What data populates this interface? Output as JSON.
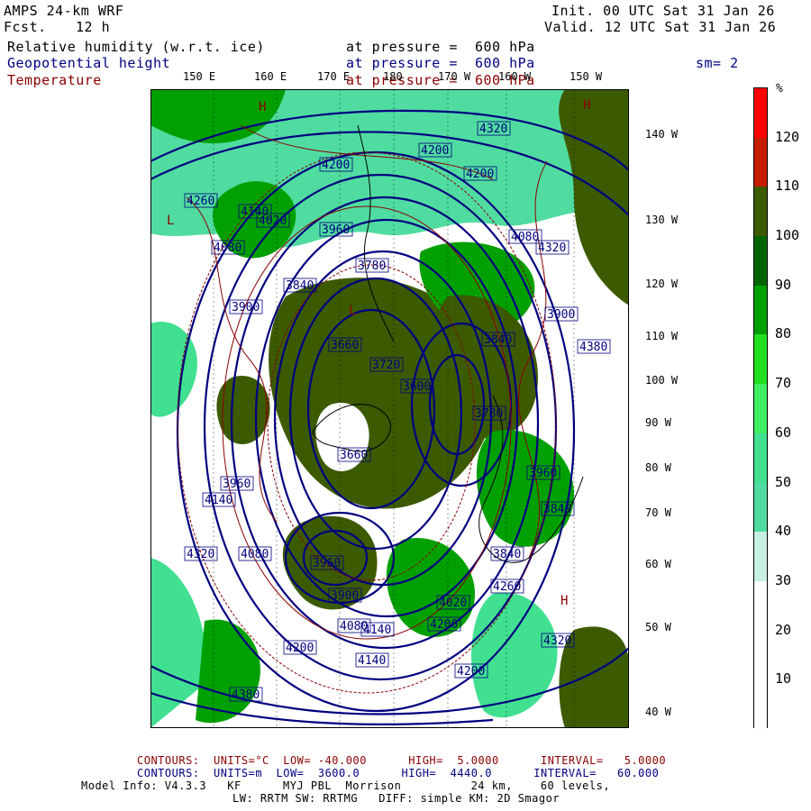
{
  "header": {
    "model": "AMPS 24-km WRF",
    "fcst_label": "Fcst.",
    "fcst_value": "12 h",
    "init": "Init. 00 UTC Sat 31 Jan 26",
    "valid": "Valid. 12 UTC Sat 31 Jan 26",
    "fields": [
      {
        "name": "Relative humidity (w.r.t. ice)",
        "level": "at pressure =  600 hPa",
        "color": "#000000"
      },
      {
        "name": "Geopotential height",
        "level": "at pressure =  600 hPa",
        "color": "#000080"
      },
      {
        "name": "Temperature",
        "level": "at pressure =  600 hPa",
        "color": "#8b0000"
      }
    ],
    "smooth": "sm= 2"
  },
  "longitude_labels": [
    "150 E",
    "160 E",
    "170 E",
    "180",
    "170 W",
    "160 W",
    "150 W"
  ],
  "latitude_labels": [
    "140 W",
    "130 W",
    "120 W",
    "110 W",
    "100 W",
    "90 W",
    "80 W",
    "70 W",
    "60 W",
    "50 W",
    "40 W"
  ],
  "colorbar": {
    "unit": "%",
    "labels": [
      "120",
      "110",
      "100",
      "90",
      "80",
      "70",
      "60",
      "50",
      "40",
      "30",
      "20",
      "10"
    ],
    "colors": [
      "#ff0000",
      "#c81e00",
      "#3c5a00",
      "#006400",
      "#00a000",
      "#20e020",
      "#40f060",
      "#40e090",
      "#50dca0",
      "#c8f0e0",
      "#ffffff",
      "#ffffff",
      "#ffffff"
    ]
  },
  "map_labels": {
    "height_labels": [
      "4320",
      "4200",
      "4200",
      "4260",
      "4140",
      "4080",
      "4200",
      "3960",
      "4020",
      "4080",
      "3840",
      "3900",
      "3780",
      "3660",
      "3720",
      "3600",
      "3660",
      "3780",
      "3840",
      "3960",
      "4140",
      "4320",
      "4080",
      "3900",
      "4020",
      "4260",
      "4200",
      "4320",
      "4380",
      "4200",
      "4140",
      "4140",
      "4200",
      "4080",
      "3960",
      "4320",
      "4380",
      "3840",
      "3960",
      "3840",
      "3900"
    ],
    "height_color": "#000080",
    "temp_color": "#8b0000",
    "rh_colors": {
      "dark": "#3c5a00",
      "green": "#00a000",
      "light": "#40e090",
      "pale": "#c8f0e0"
    }
  },
  "footer": {
    "temp_contours": "CONTOURS:  UNITS=°C  LOW= -40.000      HIGH=  5.0000      INTERVAL=   5.0000",
    "height_contours": "CONTOURS:  UNITS=m  LOW=  3600.0      HIGH=  4440.0      INTERVAL=   60.000",
    "model_info": "Model Info: V4.3.3   KF      MYJ PBL  Morrison          24 km,    60 levels,",
    "model_info2": "LW: RRTM SW: RRTMG   DIFF: simple KM: 2D Smagor"
  }
}
